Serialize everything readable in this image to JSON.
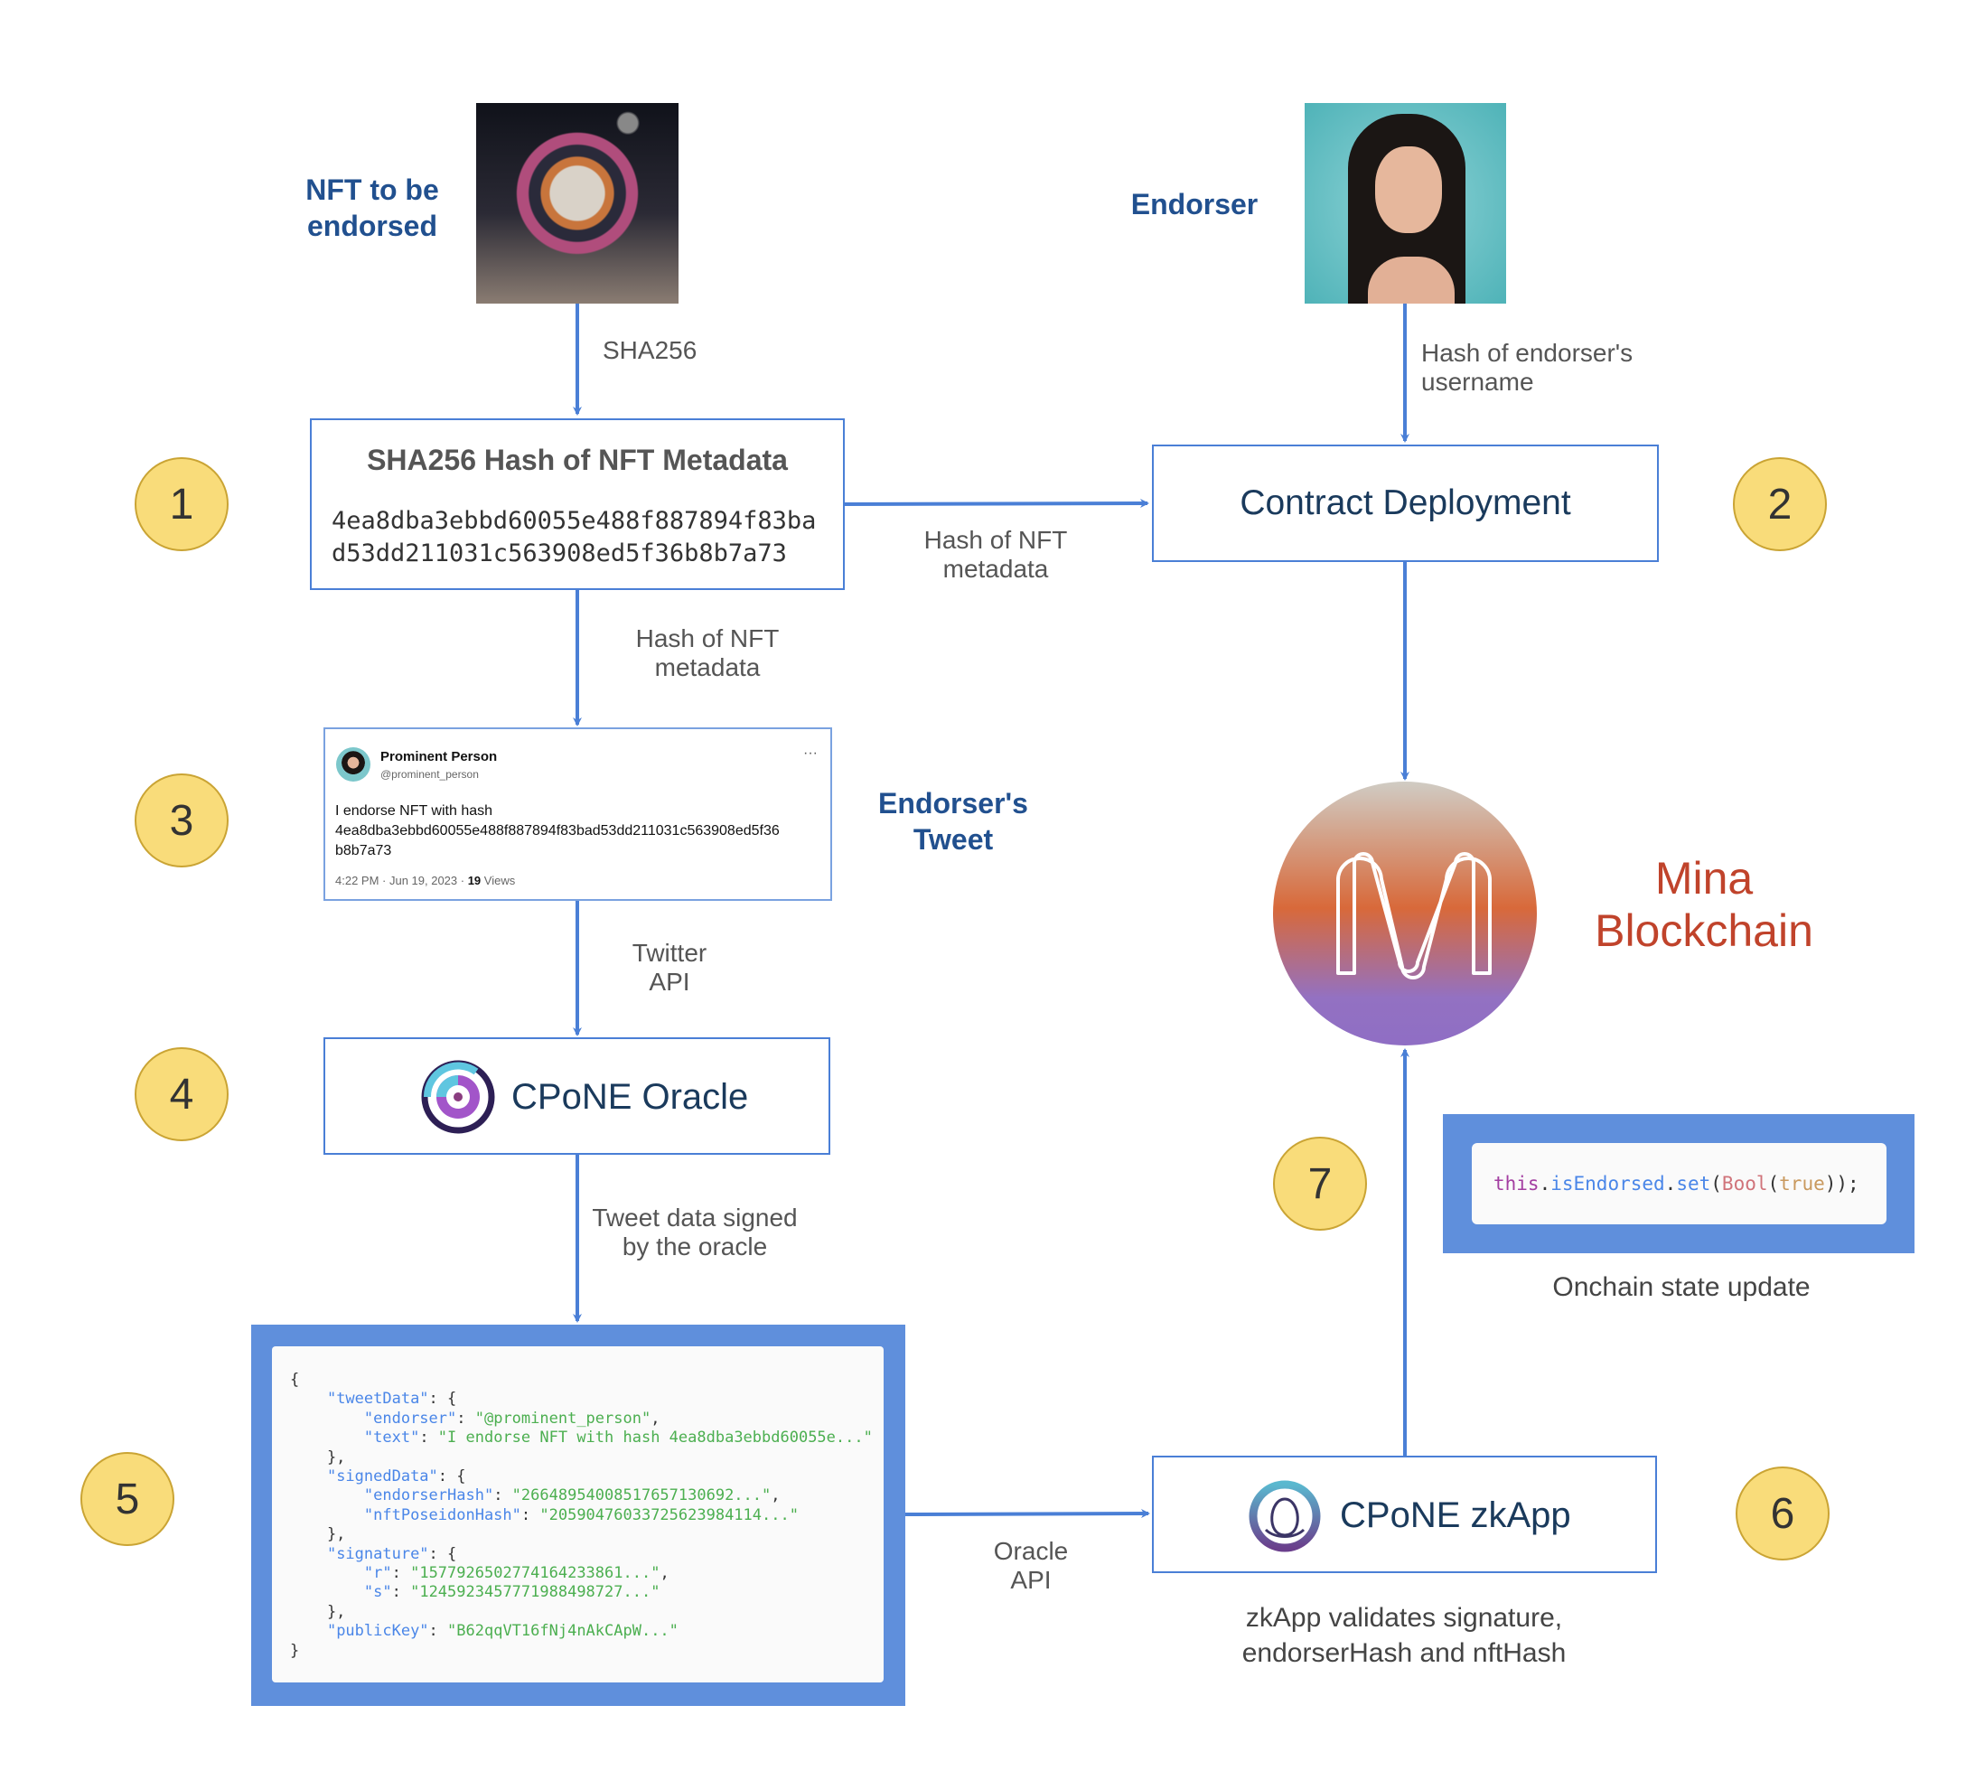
{
  "nft": {
    "label_line1": "NFT to be",
    "label_line2": "endorsed",
    "image": "astronaut-nft-image"
  },
  "endorser": {
    "label": "Endorser",
    "image": "endorser-portrait"
  },
  "arrows": {
    "sha256": "SHA256",
    "endorser_hash_line1": "Hash of endorser's",
    "endorser_hash_line2": "username",
    "nft_hash_right_line1": "Hash of NFT",
    "nft_hash_right_line2": "metadata",
    "nft_hash_down_line1": "Hash of NFT",
    "nft_hash_down_line2": "metadata",
    "twitter_api_line1": "Twitter",
    "twitter_api_line2": "API",
    "signed_line1": "Tweet data signed",
    "signed_line2": "by the oracle",
    "oracle_api_line1": "Oracle",
    "oracle_api_line2": "API"
  },
  "hash_box": {
    "title": "SHA256 Hash of NFT Metadata",
    "line1": "4ea8dba3ebbd60055e488f887894f83ba",
    "line2": "d53dd211031c563908ed5f36b8b7a73"
  },
  "contract": {
    "label": "Contract Deployment"
  },
  "tweet": {
    "name": "Prominent Person",
    "handle": "@prominent_person",
    "more": "···",
    "text_line1": "I endorse NFT with hash",
    "text_line2": "4ea8dba3ebbd60055e488f887894f83bad53dd211031c563908ed5f36",
    "text_line3": "b8b7a73",
    "timestamp": "4:22 PM · Jun 19, 2023 · ",
    "views_count": "19",
    "views_label": " Views",
    "caption_line1": "Endorser's",
    "caption_line2": "Tweet"
  },
  "oracle": {
    "label": "CPoNE Oracle"
  },
  "zkapp": {
    "label": "CPoNE zkApp",
    "caption_line1": "zkApp validates signature,",
    "caption_line2": "endorserHash and nftHash"
  },
  "mina": {
    "label_line1": "Mina",
    "label_line2": "Blockchain"
  },
  "onchain": {
    "code_this": "this",
    "code_dot1": ".",
    "code_prop": "isEndorsed",
    "code_dot2": ".",
    "code_method": "set",
    "code_open": "(",
    "code_bool": "Bool",
    "code_open2": "(",
    "code_true": "true",
    "code_close": "));",
    "caption": "Onchain state update"
  },
  "oracle_json": {
    "lines": [
      [
        [
          "p",
          "{"
        ]
      ],
      [
        [
          "p",
          "    "
        ],
        [
          "k",
          "\"tweetData\""
        ],
        [
          "p",
          ": {"
        ]
      ],
      [
        [
          "p",
          "        "
        ],
        [
          "k",
          "\"endorser\""
        ],
        [
          "p",
          ": "
        ],
        [
          "s",
          "\"@prominent_person\""
        ],
        [
          "p",
          ","
        ]
      ],
      [
        [
          "p",
          "        "
        ],
        [
          "k",
          "\"text\""
        ],
        [
          "p",
          ": "
        ],
        [
          "s",
          "\"I endorse NFT with hash 4ea8dba3ebbd60055e...\""
        ]
      ],
      [
        [
          "p",
          "    },"
        ]
      ],
      [
        [
          "p",
          "    "
        ],
        [
          "k",
          "\"signedData\""
        ],
        [
          "p",
          ": {"
        ]
      ],
      [
        [
          "p",
          "        "
        ],
        [
          "k",
          "\"endorserHash\""
        ],
        [
          "p",
          ": "
        ],
        [
          "s",
          "\"26648954008517657130692...\""
        ],
        [
          "p",
          ","
        ]
      ],
      [
        [
          "p",
          "        "
        ],
        [
          "k",
          "\"nftPoseidonHash\""
        ],
        [
          "p",
          ": "
        ],
        [
          "s",
          "\"20590476033725623984114...\""
        ]
      ],
      [
        [
          "p",
          "    },"
        ]
      ],
      [
        [
          "p",
          "    "
        ],
        [
          "k",
          "\"signature\""
        ],
        [
          "p",
          ": {"
        ]
      ],
      [
        [
          "p",
          "        "
        ],
        [
          "k",
          "\"r\""
        ],
        [
          "p",
          ": "
        ],
        [
          "s",
          "\"15779265027741642338­61...\""
        ],
        [
          "p",
          ","
        ]
      ],
      [
        [
          "p",
          "        "
        ],
        [
          "k",
          "\"s\""
        ],
        [
          "p",
          ": "
        ],
        [
          "s",
          "\"12459234577719884987­27...\""
        ]
      ],
      [
        [
          "p",
          "    },"
        ]
      ],
      [
        [
          "p",
          "    "
        ],
        [
          "k",
          "\"publicKey\""
        ],
        [
          "p",
          ": "
        ],
        [
          "s",
          "\"B62qqVT16fNj4nAkCApW...\""
        ]
      ],
      [
        [
          "p",
          "}"
        ]
      ]
    ]
  },
  "steps": [
    "1",
    "2",
    "3",
    "4",
    "5",
    "6",
    "7"
  ],
  "colors": {
    "arrow": "#4a7fd6",
    "step_fill": "#f9dc7a",
    "label_blue": "#21508f",
    "mina_red": "#c0432b",
    "code_frame": "#5f8fdc"
  }
}
